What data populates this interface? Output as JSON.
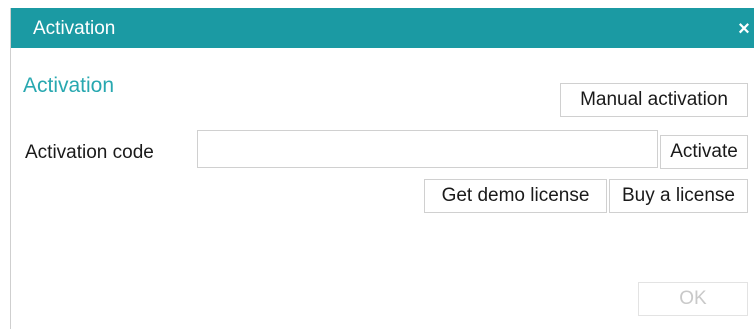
{
  "window": {
    "title": "Activation",
    "close_glyph": "×",
    "titlebar_color": "#1b9aa3"
  },
  "main": {
    "heading": "Activation",
    "heading_color": "#28a8b0",
    "manual_activation_label": "Manual activation",
    "activation_code_label": "Activation code",
    "activation_code_value": "",
    "activation_code_placeholder": "",
    "activate_label": "Activate",
    "get_demo_license_label": "Get demo license",
    "buy_license_label": "Buy a license"
  },
  "footer": {
    "ok_label": "OK",
    "ok_enabled": false
  }
}
